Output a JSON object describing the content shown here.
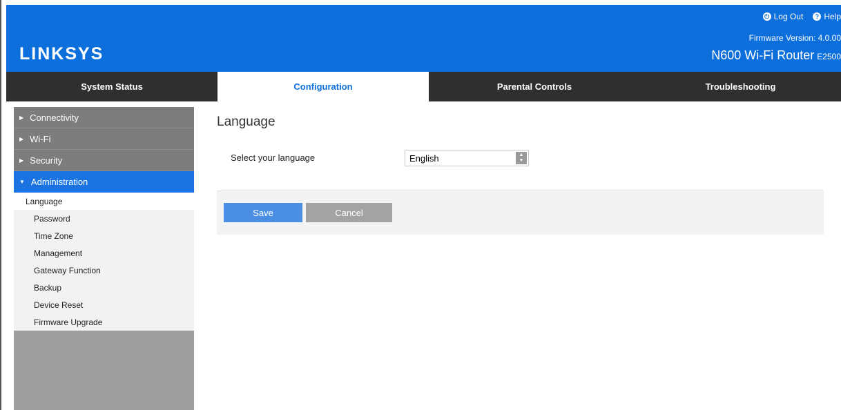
{
  "header": {
    "brand": "LINKSYS",
    "logout_label": "Log Out",
    "help_label": "Help",
    "firmware": "Firmware Version: 4.0.00",
    "model": "N600 Wi-Fi Router",
    "model_code": "E2500"
  },
  "tabs": [
    {
      "label": "System Status"
    },
    {
      "label": "Configuration"
    },
    {
      "label": "Parental Controls"
    },
    {
      "label": "Troubleshooting"
    }
  ],
  "sidebar": {
    "sections": [
      {
        "label": "Connectivity"
      },
      {
        "label": "Wi-Fi"
      },
      {
        "label": "Security"
      },
      {
        "label": "Administration"
      }
    ],
    "sub_items": [
      {
        "label": "Language"
      },
      {
        "label": "Password"
      },
      {
        "label": "Time Zone"
      },
      {
        "label": "Management"
      },
      {
        "label": "Gateway Function"
      },
      {
        "label": "Backup"
      },
      {
        "label": "Device Reset"
      },
      {
        "label": "Firmware Upgrade"
      }
    ]
  },
  "main": {
    "title": "Language",
    "language_label": "Select your language",
    "language_value": "English",
    "save_label": "Save",
    "cancel_label": "Cancel"
  },
  "colors": {
    "brand_blue": "#0d6fdb",
    "nav_dark": "#2f2f2f",
    "save_blue": "#4a8fe3"
  }
}
